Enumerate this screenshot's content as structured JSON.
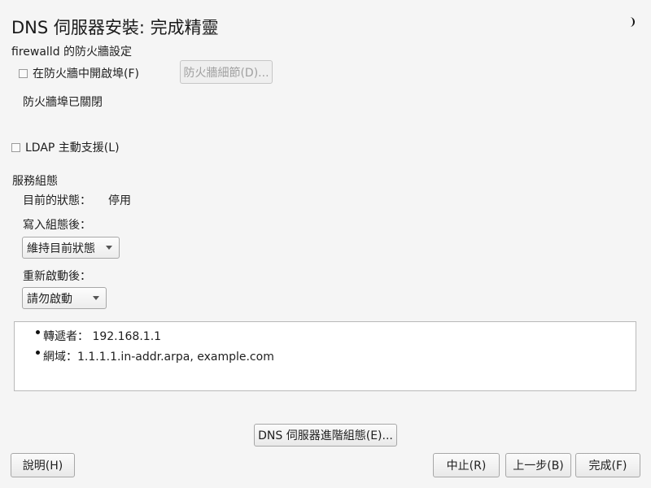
{
  "window": {
    "title": "DNS 伺服器安裝: 完成精靈"
  },
  "firewall": {
    "section_label": "firewalld 的防火牆設定",
    "open_port_label": "在防火牆中開啟埠(F)",
    "open_port_checked": false,
    "details_button": "防火牆細節(D)...",
    "status_text": "防火牆埠已關閉"
  },
  "ldap": {
    "label": "LDAP 主動支援(L)",
    "checked": false
  },
  "service": {
    "section_label": "服務組態",
    "current_state_label": "目前的狀態：",
    "current_state_value": "停用",
    "after_write_label": "寫入組態後：",
    "after_write_value": "維持目前狀態",
    "after_reboot_label": "重新啟動後：",
    "after_reboot_value": "請勿啟動"
  },
  "summary": {
    "items": [
      {
        "text": "轉遞者： 192.168.1.1"
      },
      {
        "text": "網域：1.1.1.1.in-addr.arpa, example.com"
      }
    ]
  },
  "buttons": {
    "advanced": "DNS 伺服器進階組態(E)...",
    "help": "說明(H)",
    "abort": "中止(R)",
    "back": "上一步(B)",
    "finish": "完成(F)"
  },
  "icons": {
    "top_right": "moon-icon"
  }
}
